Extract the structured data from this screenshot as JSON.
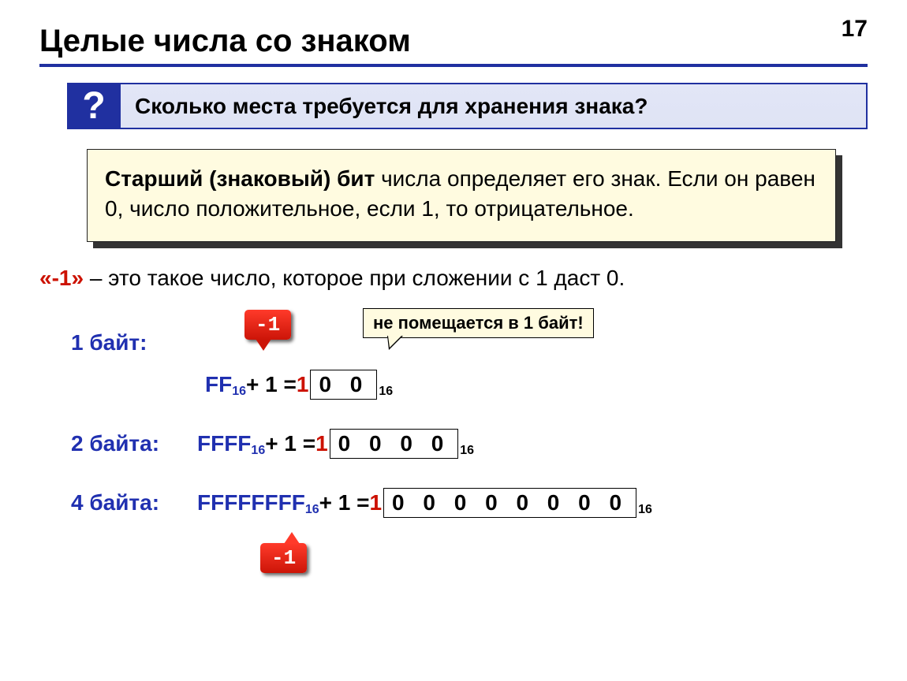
{
  "page_number": "17",
  "title": "Целые числа со знаком",
  "question": {
    "badge": "?",
    "text": "Сколько места требуется для хранения знака?"
  },
  "info": {
    "bold": "Старший (знаковый) бит",
    "rest": " числа определяет его знак. Если он равен 0, число положительное, если 1, то отрицательное."
  },
  "definition": {
    "neg": "«-1»",
    "rest": " – это такое число, которое при сложении с 1 даст 0."
  },
  "callouts": {
    "neg1_top": "-1",
    "neg1_bot": "-1",
    "overflow": "не помещается в 1 байт!"
  },
  "rows": {
    "r1": {
      "label": "1 байт:",
      "hex": "FF",
      "sub1": "16",
      "mid": " + 1 = ",
      "carry": "1",
      "zeros": "0 0",
      "sub2": "16"
    },
    "r2": {
      "label": "2 байта:",
      "hex": "FFFF",
      "sub1": "16",
      "mid": " + 1 = ",
      "carry": "1",
      "zeros": "0 0 0 0",
      "sub2": "16"
    },
    "r3": {
      "label": "4 байта:",
      "hex": "FFFFFFFF",
      "sub1": "16",
      "mid": " + 1 = ",
      "carry": "1",
      "zeros": "0 0 0 0 0 0 0 0",
      "sub2": "16"
    }
  }
}
